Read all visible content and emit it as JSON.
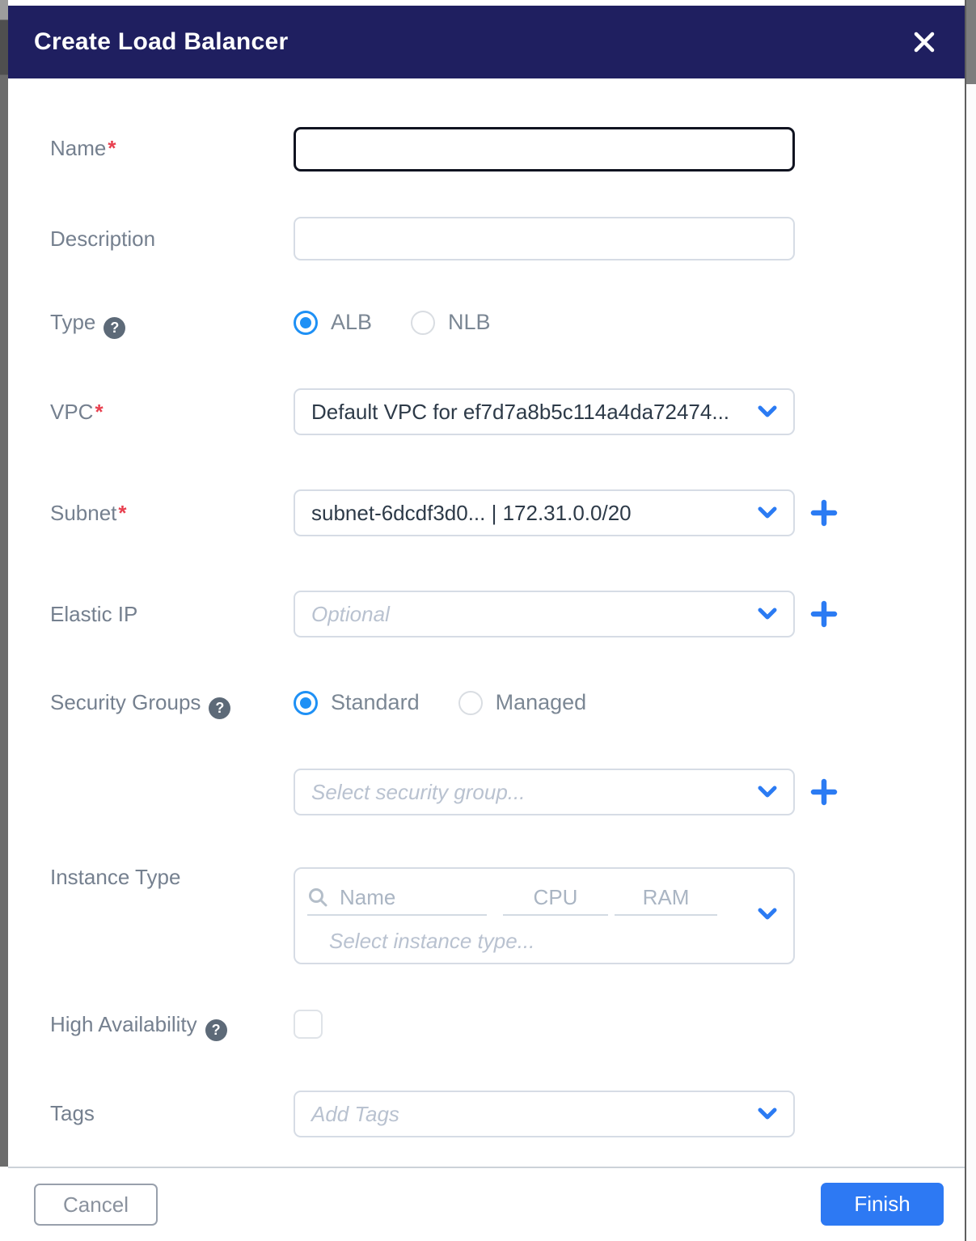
{
  "modal": {
    "title": "Create Load Balancer"
  },
  "icons": {
    "help_glyph": "?"
  },
  "ui": {
    "required_mark": "*"
  },
  "fields": {
    "name": {
      "label": "Name",
      "required": true,
      "value": ""
    },
    "description": {
      "label": "Description",
      "value": ""
    },
    "type": {
      "label": "Type",
      "options": [
        "ALB",
        "NLB"
      ],
      "selected": "ALB"
    },
    "vpc": {
      "label": "VPC",
      "required": true,
      "value": "Default VPC for ef7d7a8b5c114a4da72474..."
    },
    "subnet": {
      "label": "Subnet",
      "required": true,
      "value": "subnet-6dcdf3d0... | 172.31.0.0/20"
    },
    "elastic_ip": {
      "label": "Elastic IP",
      "placeholder": "Optional"
    },
    "security_groups": {
      "label": "Security Groups",
      "options": [
        "Standard",
        "Managed"
      ],
      "selected": "Standard",
      "placeholder": "Select security group..."
    },
    "instance_type": {
      "label": "Instance Type",
      "search_placeholder": "Name",
      "cpu_label": "CPU",
      "ram_label": "RAM",
      "placeholder": "Select instance type..."
    },
    "high_availability": {
      "label": "High Availability",
      "checked": false
    },
    "tags": {
      "label": "Tags",
      "placeholder": "Add Tags"
    }
  },
  "footer": {
    "cancel_label": "Cancel",
    "finish_label": "Finish"
  },
  "colors": {
    "header_bg": "#1f1f60",
    "accent_blue": "#2b7bf3",
    "finish_button_bg": "#2d79f3",
    "required_red": "#e8404f",
    "label_gray": "#75808f",
    "value_dark": "#2d3a48",
    "placeholder_gray": "#b9c2d0",
    "border_gray": "#d6dce5"
  }
}
